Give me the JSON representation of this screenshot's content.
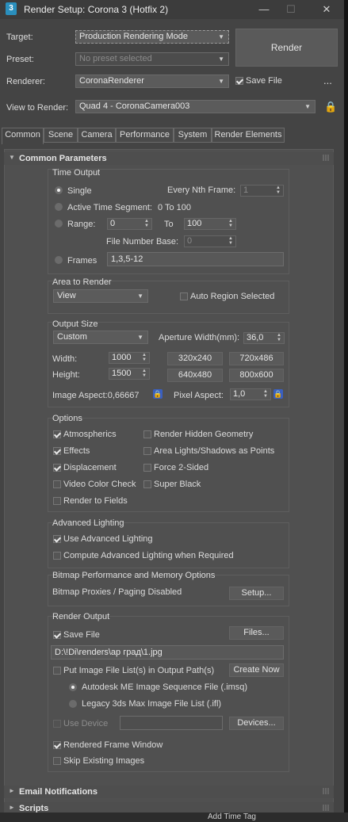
{
  "window": {
    "title": "Render Setup: Corona 3 (Hotfix 2)",
    "icon_label": "3",
    "minimize": "—",
    "maximize": "☐",
    "close": "✕"
  },
  "top": {
    "target_label": "Target:",
    "target_value": "Production Rendering Mode",
    "preset_label": "Preset:",
    "preset_value": "No preset selected",
    "renderer_label": "Renderer:",
    "renderer_value": "CoronaRenderer",
    "save_file_label": "Save File",
    "save_file_checked": true,
    "more": "...",
    "view_label": "View to Render:",
    "view_value": "Quad 4 - CoronaCamera003",
    "render_button": "Render"
  },
  "tabs": [
    "Common",
    "Scene",
    "Camera",
    "Performance",
    "System",
    "Render Elements"
  ],
  "rollouts": {
    "common_parameters": "Common Parameters",
    "email": "Email Notifications",
    "scripts": "Scripts"
  },
  "time_output": {
    "title": "Time Output",
    "single": "Single",
    "every_nth": "Every Nth Frame:",
    "every_nth_value": "1",
    "active_segment": "Active Time Segment:",
    "active_range": "0 To 100",
    "range": "Range:",
    "range_from": "0",
    "to": "To",
    "range_to": "100",
    "file_number_base": "File Number Base:",
    "file_number_value": "0",
    "frames": "Frames",
    "frames_value": "1,3,5-12"
  },
  "area": {
    "title": "Area to Render",
    "value": "View",
    "auto_region": "Auto Region Selected"
  },
  "output_size": {
    "title": "Output Size",
    "preset": "Custom",
    "aperture_label": "Aperture Width(mm):",
    "aperture_value": "36,0",
    "width_label": "Width:",
    "width_value": "1000",
    "height_label": "Height:",
    "height_value": "1500",
    "presets": [
      "320x240",
      "720x486",
      "640x480",
      "800x600"
    ],
    "image_aspect": "Image Aspect:0,66667",
    "pixel_aspect_label": "Pixel Aspect:",
    "pixel_aspect_value": "1,0"
  },
  "options": {
    "title": "Options",
    "left": [
      "Atmospherics",
      "Effects",
      "Displacement",
      "Video Color Check",
      "Render to Fields"
    ],
    "right": [
      "Render Hidden Geometry",
      "Area Lights/Shadows as Points",
      "Force 2-Sided",
      "Super Black"
    ]
  },
  "advanced_lighting": {
    "title": "Advanced Lighting",
    "use": "Use Advanced Lighting",
    "compute": "Compute Advanced Lighting when Required"
  },
  "bitmap": {
    "title": "Bitmap Performance and Memory Options",
    "status": "Bitmap Proxies / Paging Disabled",
    "setup": "Setup..."
  },
  "render_output": {
    "title": "Render Output",
    "save_file": "Save File",
    "files": "Files...",
    "path": "D:\\!Di\\renders\\ар град\\1.jpg",
    "put_list": "Put Image File List(s) in Output Path(s)",
    "create_now": "Create Now",
    "autodesk_seq": "Autodesk ME Image Sequence File (.imsq)",
    "legacy": "Legacy 3ds Max Image File List (.ifl)",
    "use_device": "Use Device",
    "devices": "Devices...",
    "rendered_frame_window": "Rendered Frame Window",
    "skip_existing": "Skip Existing Images"
  },
  "background_hint": "Add Time Tag",
  "colors": {
    "bg": "#444444",
    "panel": "#505050",
    "accent_lock": "#3a5fbf",
    "app_icon": "#2a8fbd"
  }
}
